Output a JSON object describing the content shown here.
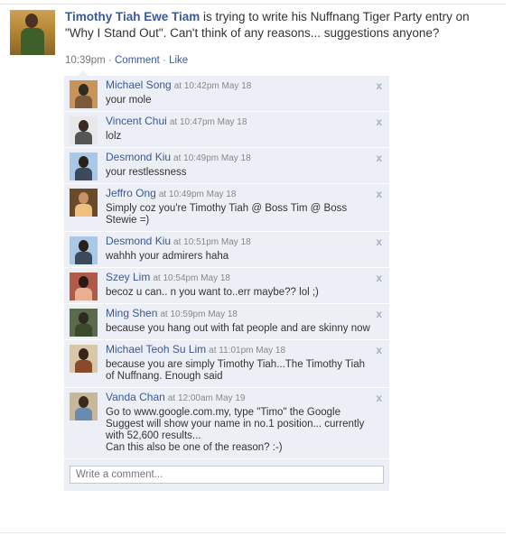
{
  "post": {
    "author": "Timothy Tiah Ewe Tiam",
    "text": " is trying to write his Nuffnang Tiger Party entry on \"Why I Stand Out\". Can't think of any reasons... suggestions anyone?",
    "time": "10:39pm",
    "sep1": " · ",
    "comment_link": "Comment",
    "sep2": " · ",
    "like_link": "Like"
  },
  "comments": [
    {
      "name": "Michael Song",
      "time": "at 10:42pm May 18",
      "text": "your mole"
    },
    {
      "name": "Vincent Chui",
      "time": "at 10:47pm May 18",
      "text": "lolz"
    },
    {
      "name": "Desmond Kiu",
      "time": "at 10:49pm May 18",
      "text": "your restlessness"
    },
    {
      "name": "Jeffro Ong",
      "time": "at 10:49pm May 18",
      "text": "Simply coz you're Timothy Tiah @ Boss Tim @ Boss Stewie =)"
    },
    {
      "name": "Desmond Kiu",
      "time": "at 10:51pm May 18",
      "text": "wahhh your admirers haha"
    },
    {
      "name": "Szey Lim",
      "time": "at 10:54pm May 18",
      "text": "becoz u can.. n you want to..err maybe?? lol ;)"
    },
    {
      "name": "Ming Shen",
      "time": "at 10:59pm May 18",
      "text": "because you hang out with fat people and are skinny now"
    },
    {
      "name": "Michael Teoh Su Lim",
      "time": "at 11:01pm May 18",
      "text": "because you are simply Timothy Tiah...The Timothy Tiah of Nuffnang. Enough said"
    },
    {
      "name": "Vanda Chan",
      "time": "at 12:00am May 19",
      "text": "Go to www.google.com.my, type \"Timo\" the Google Suggest will show your name in no.1 position... currently with 52,600 results...\nCan this also be one of the reason? :-)"
    }
  ],
  "close_glyph": "x",
  "write_placeholder": "Write a comment...",
  "colors": {
    "link": "#3b5998",
    "comment_bg": "#eceff5",
    "meta": "#777777"
  }
}
